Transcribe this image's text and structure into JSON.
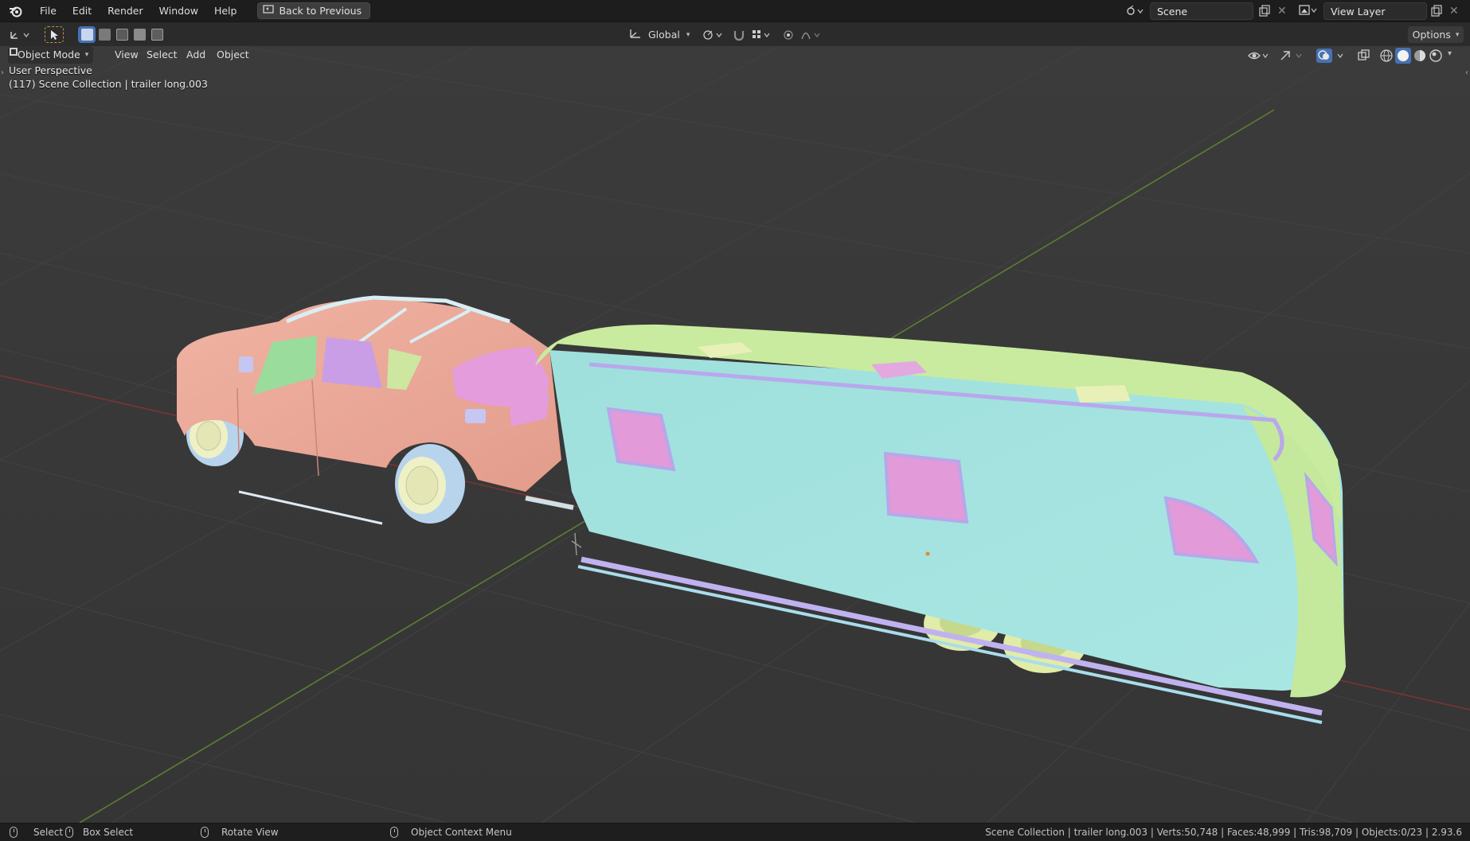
{
  "menubar": {
    "items": [
      "File",
      "Edit",
      "Render",
      "Window",
      "Help"
    ],
    "back_label": "Back to Previous",
    "scene_label": "Scene",
    "view_layer_label": "View Layer"
  },
  "header": {
    "transform_orientation": "Global",
    "options_label": "Options"
  },
  "viewport_menu": {
    "mode_label": "Object Mode",
    "items": [
      "View",
      "Select",
      "Add",
      "Object"
    ]
  },
  "viewport": {
    "perspective_label": "User Perspective",
    "collection_label": "(117) Scene Collection | trailer long.003"
  },
  "statusbar": {
    "hints": [
      "Select",
      "Box Select",
      "Rotate View",
      "Object Context Menu"
    ],
    "stats": "Scene Collection | trailer long.003 | Verts:50,748 | Faces:48,999 | Tris:98,709 | Objects:0/23 | 2.93.6"
  },
  "colors": {
    "car_body": "#e8a898",
    "trailer_side": "#a3e3df",
    "trailer_roof": "#c8ec9e",
    "window_pink": "#e09ad8",
    "grid_green_axis": "#6e9d3a",
    "grid_red_axis": "#a53c3c"
  }
}
